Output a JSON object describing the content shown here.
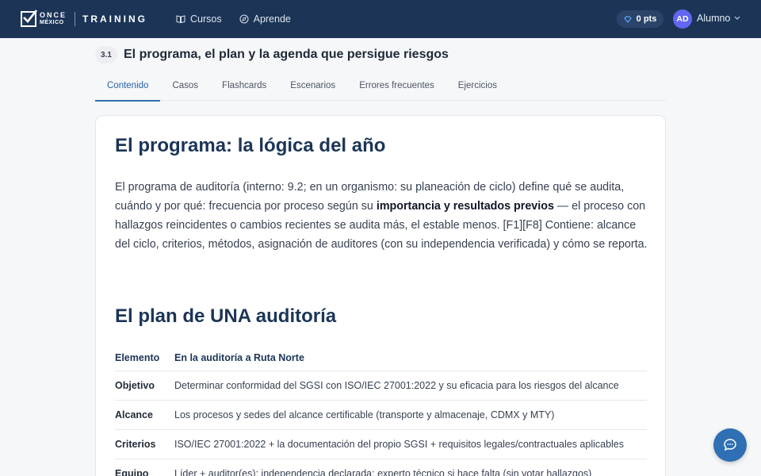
{
  "header": {
    "logo_line1": "ONCE",
    "logo_line2": "MÉXICO",
    "brand": "TRAINING",
    "nav": [
      {
        "label": "Cursos",
        "icon": "book-icon"
      },
      {
        "label": "Aprende",
        "icon": "compass-icon"
      }
    ],
    "points": "0 pts",
    "user": {
      "initials": "AD",
      "name": "Alumno"
    }
  },
  "section": {
    "number": "3.1",
    "title": "El programa, el plan y la agenda que persigue riesgos"
  },
  "tabs": [
    "Contenido",
    "Casos",
    "Flashcards",
    "Escenarios",
    "Errores frecuentes",
    "Ejercicios"
  ],
  "active_tab": "Contenido",
  "content": {
    "heading1": "El programa: la lógica del año",
    "para_part1": "El programa de auditoría (interno: 9.2; en un organismo: su planeación de ciclo) define qué se audita, cuándo y por qué: frecuencia por proceso según su ",
    "para_bold": "importancia y resultados previos",
    "para_part2": " — el proceso con hallazgos reincidentes o cambios recientes se audita más, el estable menos. [F1][F8] Contiene: alcance del ciclo, criterios, métodos, asignación de auditores (con su independencia verificada) y cómo se reporta.",
    "heading2": "El plan de UNA auditoría",
    "table": {
      "headers": [
        "Elemento",
        "En la auditoría a Ruta Norte"
      ],
      "rows": [
        [
          "Objetivo",
          "Determinar conformidad del SGSI con ISO/IEC 27001:2022 y su eficacia para los riesgos del alcance"
        ],
        [
          "Alcance",
          "Los procesos y sedes del alcance certificable (transporte y almacenaje, CDMX y MTY)"
        ],
        [
          "Criterios",
          "ISO/IEC 27001:2022 + la documentación del propio SGSI + requisitos legales/contractuales aplicables"
        ],
        [
          "Equipo",
          "Líder + auditor(es); independencia declarada; experto técnico si hace falta (sin votar hallazgos)"
        ]
      ]
    }
  },
  "colors": {
    "topbar": "#1c3557",
    "accent": "#2f6fb3",
    "avatar": "#6366f1"
  }
}
